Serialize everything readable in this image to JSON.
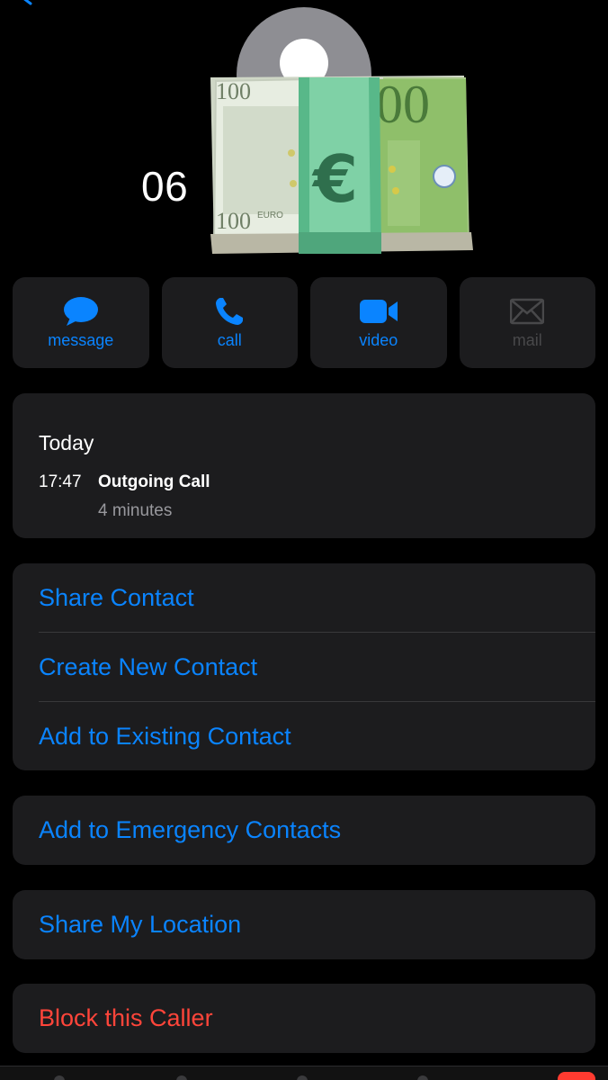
{
  "caller": {
    "number": "06"
  },
  "actions": [
    {
      "label": "message",
      "icon": "message-bubble-icon",
      "enabled": true
    },
    {
      "label": "call",
      "icon": "phone-icon",
      "enabled": true
    },
    {
      "label": "video",
      "icon": "video-camera-icon",
      "enabled": true
    },
    {
      "label": "mail",
      "icon": "envelope-icon",
      "enabled": false
    }
  ],
  "recents": {
    "day": "Today",
    "time": "17:47",
    "type": "Outgoing Call",
    "duration": "4 minutes"
  },
  "contact_options": [
    "Share Contact",
    "Create New Contact",
    "Add to Existing Contact"
  ],
  "emergency": "Add to Emergency Contacts",
  "location": "Share My Location",
  "block": "Block this Caller",
  "colors": {
    "accent": "#0a84ff",
    "destructive": "#ff453a",
    "card": "#1c1c1e",
    "background": "#000000"
  }
}
